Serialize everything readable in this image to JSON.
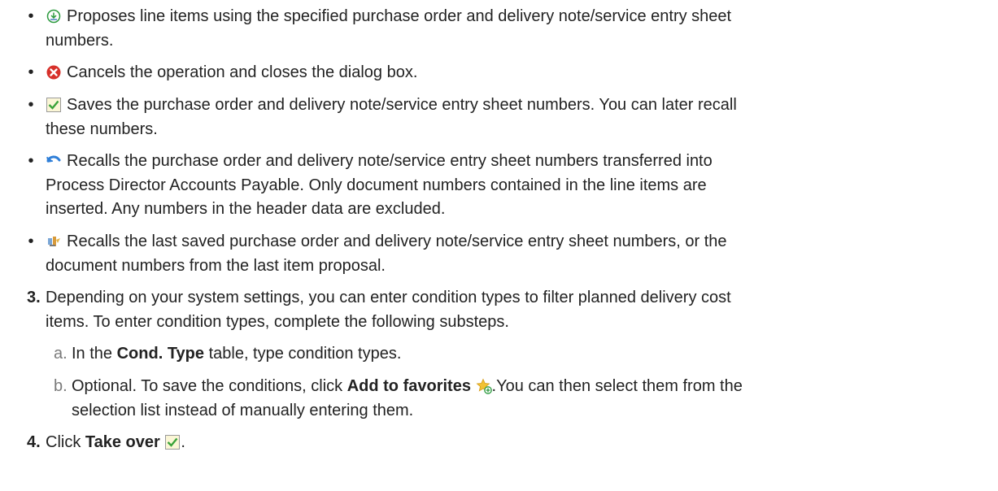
{
  "bullets": [
    {
      "icon": "propose-items-icon",
      "lines": [
        "Proposes line items using the specified purchase order and delivery note/service entry sheet",
        "numbers."
      ]
    },
    {
      "icon": "cancel-icon",
      "lines": [
        "Cancels the operation and closes the dialog box."
      ]
    },
    {
      "icon": "save-checkbox-icon",
      "lines": [
        "Saves the purchase order and delivery note/service entry sheet numbers. You can later recall",
        "these numbers."
      ]
    },
    {
      "icon": "recall-transferred-icon",
      "lines": [
        "Recalls the purchase order and delivery note/service entry sheet numbers transferred into",
        "Process Director Accounts Payable. Only document numbers contained in the line items are",
        "inserted. Any numbers in the header data are excluded."
      ]
    },
    {
      "icon": "recall-last-saved-icon",
      "lines": [
        "Recalls the last saved purchase order and delivery note/service entry sheet numbers, or the",
        "document numbers from the last item proposal."
      ]
    }
  ],
  "bullet_char": "•",
  "step3": {
    "number": "3.",
    "lines": [
      "Depending on your system settings, you can enter condition types to filter planned delivery cost",
      "items. To enter condition types, complete the following substeps."
    ],
    "substeps": [
      {
        "letter": "a.",
        "before": "In the ",
        "bold": "Cond. Type",
        "after": " table, type condition types."
      },
      {
        "letter": "b.",
        "before": "Optional. To save the conditions, click ",
        "bold": "Add to favorites",
        "after": ".You can then select them from the",
        "line2": "selection list instead of manually entering them."
      }
    ]
  },
  "step4": {
    "number": "4.",
    "before": "Click ",
    "bold": "Take over",
    "after": "."
  }
}
